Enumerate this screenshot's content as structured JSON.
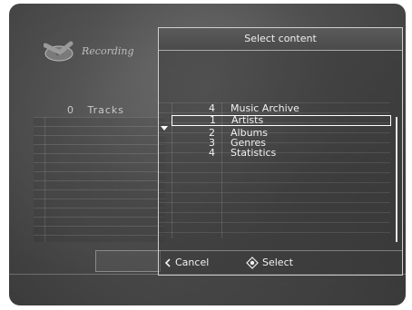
{
  "background": {
    "recording_label": "Recording",
    "tracks_count": "0",
    "tracks_label": "Tracks"
  },
  "dialog": {
    "title": "Select content",
    "header_row": {
      "num": "4",
      "name": "Music Archive"
    },
    "items": [
      {
        "num": "1",
        "name": "Artists",
        "selected": true
      },
      {
        "num": "2",
        "name": "Albums"
      },
      {
        "num": "3",
        "name": "Genres"
      },
      {
        "num": "4",
        "name": "Statistics"
      }
    ],
    "cancel_label": "Cancel",
    "select_label": "Select"
  },
  "colors": {
    "background": "#4e4e4e",
    "text": "#f2f2f2",
    "border": "#cfcfcf"
  },
  "icons": [
    "cd-icon",
    "chevron-left-icon",
    "select-diamond-icon",
    "dropdown-arrow-icon"
  ]
}
